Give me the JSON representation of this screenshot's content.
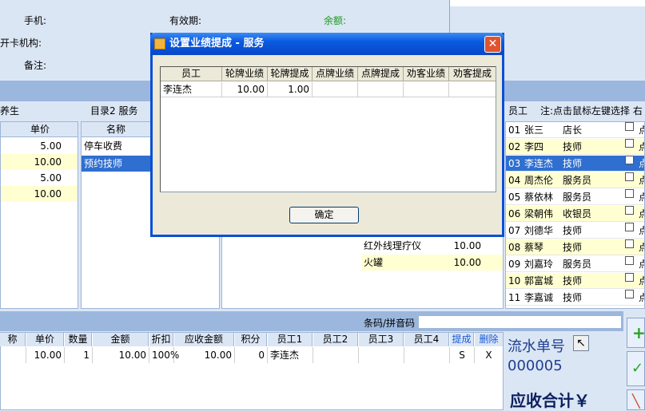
{
  "top_info": {
    "phone_label": "手机:",
    "validity_label": "有效期:",
    "balance_label": "余额:",
    "issuer_label": "开卡机构:",
    "remark_label": "备注:"
  },
  "left_category": {
    "partial_label": "养生"
  },
  "price_list": {
    "header": "单价",
    "values": [
      "5.00",
      "10.00",
      "5.00",
      "10.00"
    ]
  },
  "directory": {
    "label": "目录2 服务",
    "header": "名称",
    "items": [
      "停车收费",
      "预约技师"
    ],
    "selected_index": 1
  },
  "middle_items": [
    {
      "name": "红外线理疗仪",
      "price": "10.00"
    },
    {
      "name": "火罐",
      "price": "10.00"
    }
  ],
  "employee_panel": {
    "header_col": "员工",
    "hint": "注:点击鼠标左键选择 右",
    "rows": [
      {
        "no": "01",
        "name": "张三",
        "role": "店长"
      },
      {
        "no": "02",
        "name": "李四",
        "role": "技师"
      },
      {
        "no": "03",
        "name": "李连杰",
        "role": "技师"
      },
      {
        "no": "04",
        "name": "周杰伦",
        "role": "服务员"
      },
      {
        "no": "05",
        "name": "蔡依林",
        "role": "服务员"
      },
      {
        "no": "06",
        "name": "梁朝伟",
        "role": "收银员"
      },
      {
        "no": "07",
        "name": "刘德华",
        "role": "技师"
      },
      {
        "no": "08",
        "name": "蔡琴",
        "role": "技师"
      },
      {
        "no": "09",
        "name": "刘嘉玲",
        "role": "服务员"
      },
      {
        "no": "10",
        "name": "郭富城",
        "role": "技师"
      },
      {
        "no": "11",
        "name": "李嘉诚",
        "role": "技师"
      }
    ],
    "selected_index": 2,
    "trailing_char": "点"
  },
  "barcode": {
    "label": "条码/拼音码",
    "value": ""
  },
  "order_table": {
    "headers": [
      "称",
      "单价",
      "数量",
      "金额",
      "折扣",
      "应收金额",
      "积分",
      "员工1",
      "员工2",
      "员工3",
      "员工4"
    ],
    "commission_link": "提成",
    "delete_link": "删除",
    "row": {
      "name": "",
      "price": "10.00",
      "qty": "1",
      "amount": "10.00",
      "discount": "100%",
      "receivable": "10.00",
      "points": "0",
      "staff1": "李连杰",
      "staff2": "",
      "staff3": "",
      "staff4": "",
      "commission": "S",
      "delete": "X"
    }
  },
  "serial": {
    "label": "流水单号",
    "value": "000005"
  },
  "total_label": "应收合计￥",
  "dialog": {
    "title": "设置业绩提成 - 服务",
    "columns": [
      "员工",
      "轮牌业绩",
      "轮牌提成",
      "点牌业绩",
      "点牌提成",
      "劝客业绩",
      "劝客提成"
    ],
    "row": [
      "李连杰",
      "10.00",
      "1.00",
      "",
      "",
      "",
      ""
    ],
    "ok_label": "确定",
    "close_glyph": "✕"
  }
}
